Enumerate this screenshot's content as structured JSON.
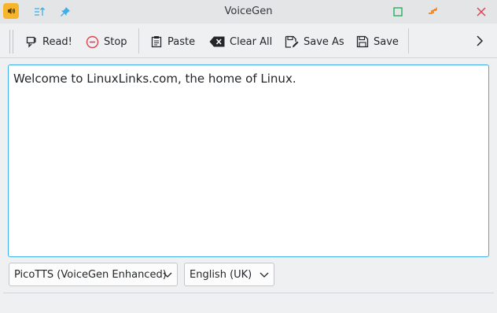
{
  "window": {
    "title": "VoiceGen"
  },
  "toolbar": {
    "read_label": "Read!",
    "stop_label": "Stop",
    "paste_label": "Paste",
    "clear_label": "Clear All",
    "save_as_label": "Save As",
    "save_label": "Save"
  },
  "editor": {
    "text": "Welcome to LinuxLinks.com, the home of Linux."
  },
  "engine_select": {
    "value": "PicoTTS (VoiceGen Enhanced)"
  },
  "language_select": {
    "value": "English (UK)"
  },
  "colors": {
    "accent": "#3daee9",
    "close": "#da4453",
    "app_icon": "#f6b52a",
    "stop_icon": "#da4453",
    "maximize": "#27ae60",
    "keep_above": "#f67400"
  }
}
